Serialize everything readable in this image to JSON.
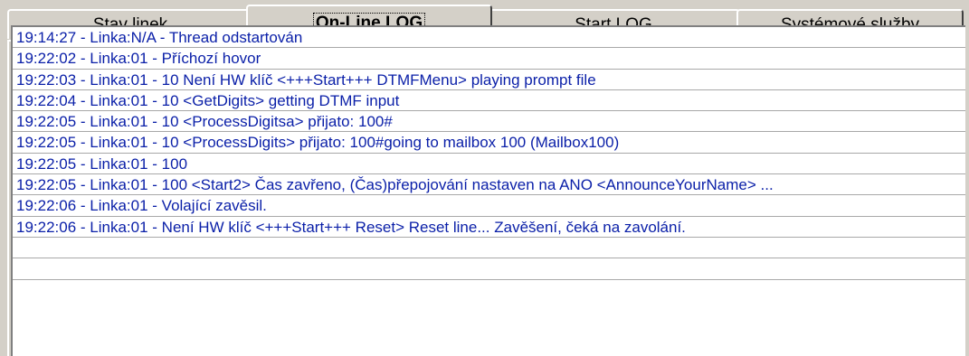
{
  "tabs": [
    {
      "label": "Stav linek",
      "active": false
    },
    {
      "label": "On-Line LOG",
      "active": true
    },
    {
      "label": "Start LOG",
      "active": false
    },
    {
      "label": "Systémové služby",
      "active": false
    }
  ],
  "log": {
    "entries": [
      "19:14:27 - Linka:N/A - Thread odstartován",
      "19:22:02 - Linka:01 - Příchozí hovor",
      "19:22:03 - Linka:01 - 10 Není HW klíč <+++Start+++ DTMFMenu> playing prompt file",
      "19:22:04 - Linka:01 - 10  <GetDigits> getting DTMF input",
      "19:22:05 - Linka:01 - 10  <ProcessDigitsa> přijato: 100#",
      "19:22:05 - Linka:01 - 10  <ProcessDigits> přijato: 100#going to mailbox 100 (Mailbox100)",
      "19:22:05 - Linka:01 - 100",
      "19:22:05 - Linka:01 - 100  <Start2> Čas zavřeno, (Čas)přepojování nastaven na ANO <AnnounceYourName> ...",
      "19:22:06 - Linka:01 - Volající zavěsil.",
      "19:22:06 - Linka:01 - Není HW klíč <+++Start+++ Reset> Reset line... Zavěšení, čeká na zavolání.",
      "",
      ""
    ]
  },
  "colors": {
    "log_text": "#0a1fa8",
    "face": "#d4d0c8"
  }
}
